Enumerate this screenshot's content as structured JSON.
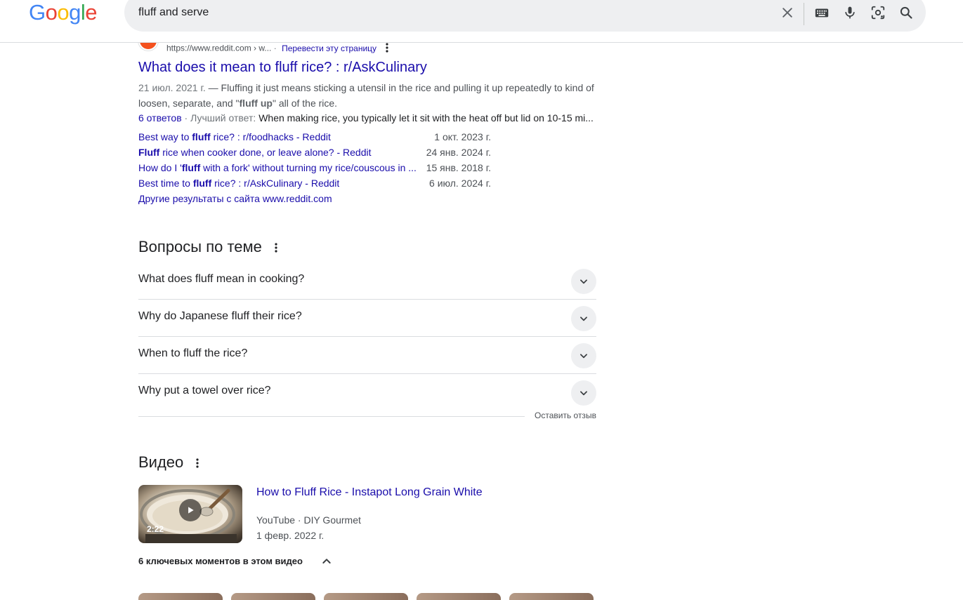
{
  "header": {
    "logo": "Google",
    "search_value": "fluff and serve"
  },
  "result": {
    "url": "https://www.reddit.com › w...",
    "translate": "Перевести эту страницу",
    "title": "What does it mean to fluff rice? : r/AskCulinary",
    "snippet_date": "21 июл. 2021 г.",
    "snippet_part1": " — Fluffing it just means sticking a utensil in the rice and pulling it up repeatedly to kind of loosen, separate, and \"",
    "snippet_bold1": "fluff",
    "snippet_mid": " ",
    "snippet_bold2": "up",
    "snippet_part2": "\" all of the rice.",
    "answers_count": "6 ответов",
    "best_label": " · Лучший ответ: ",
    "best_text": "When making rice, you typically let it sit with the heat off but lid on 10-15 mi...",
    "sitelinks": [
      {
        "pre": "Best way to ",
        "bold": "fluff",
        "post": " rice? : r/foodhacks - Reddit",
        "date": "1 окт. 2023 г."
      },
      {
        "pre": "",
        "bold": "Fluff",
        "post": " rice when cooker done, or leave alone? - Reddit",
        "date": "24 янв. 2024 г."
      },
      {
        "pre": "How do I '",
        "bold": "fluff",
        "post": " with a fork' without turning my rice/couscous in ...",
        "date": "15 янв. 2018 г."
      },
      {
        "pre": "Best time to ",
        "bold": "fluff",
        "post": " rice? : r/AskCulinary - Reddit",
        "date": "6 июл. 2024 г."
      }
    ],
    "more_results": "Другие результаты с сайта www.reddit.com"
  },
  "faq": {
    "title": "Вопросы по теме",
    "questions": [
      "What does fluff mean in cooking?",
      "Why do Japanese fluff their rice?",
      "When to fluff the rice?",
      "Why put a towel over rice?"
    ],
    "feedback": "Оставить отзыв"
  },
  "videos": {
    "title": "Видео",
    "items": [
      {
        "title": "How to Fluff Rice - Instapot Long Grain White",
        "source": "YouTube · DIY Gourmet",
        "date": "1 февр. 2022 г.",
        "duration": "2:22"
      }
    ],
    "key_moments": "6 ключевых моментов в этом видео"
  },
  "colors": {
    "link": "#1a0dab",
    "text": "#202124",
    "muted": "#4d5156",
    "searchbox": "#eeeff1"
  }
}
